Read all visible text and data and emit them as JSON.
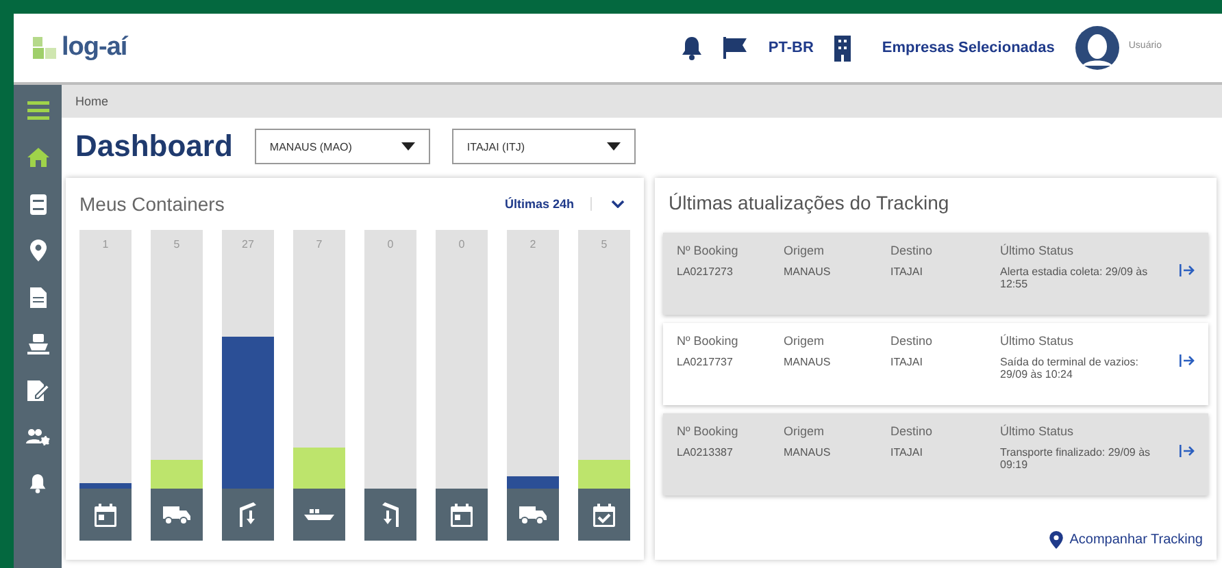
{
  "header": {
    "logo": "log-aí",
    "language": "PT-BR",
    "companies": "Empresas Selecionadas",
    "user": "Usuário"
  },
  "sidebar": {
    "items": [
      {
        "kind": "home",
        "selected": true
      },
      {
        "kind": "book",
        "selected": false
      },
      {
        "kind": "pin",
        "selected": false
      },
      {
        "kind": "document",
        "selected": false
      },
      {
        "kind": "ship",
        "selected": false
      },
      {
        "kind": "signature",
        "selected": false
      },
      {
        "kind": "people",
        "selected": false
      },
      {
        "kind": "bell",
        "selected": false
      }
    ]
  },
  "breadcrumb": "Home",
  "title": "Dashboard",
  "filters": [
    {
      "value": "MANAUS (MAO)"
    },
    {
      "value": "ITAJAI (ITJ)"
    }
  ],
  "containers": {
    "title": "Meus Containers",
    "period": "Últimas 24h",
    "bars": [
      {
        "count": "1",
        "level": 0.02,
        "color": "#2b4f96",
        "kind": "calendar"
      },
      {
        "count": "5",
        "level": 0.11,
        "color": "#bde46c",
        "kind": "truck"
      },
      {
        "count": "27",
        "level": 0.59,
        "color": "#2b4f96",
        "kind": "crane"
      },
      {
        "count": "7",
        "level": 0.16,
        "color": "#bde46c",
        "kind": "ship"
      },
      {
        "count": "0",
        "level": 0,
        "kind": "crane-mirror"
      },
      {
        "count": "0",
        "level": 0,
        "kind": "calendar"
      },
      {
        "count": "2",
        "level": 0.05,
        "color": "#2b4f96",
        "kind": "truck"
      },
      {
        "count": "5",
        "level": 0.11,
        "color": "#bde46c",
        "kind": "calendar-check"
      }
    ]
  },
  "tracking": {
    "title": "Últimas atualizações do Tracking",
    "rows": [
      {
        "highlighted": true,
        "booking_label": "Nº Booking",
        "booking": "LA0217273",
        "origin_label": "Origem",
        "origin": "MANAUS",
        "destination_label": "Destino",
        "destination": "ITAJAI",
        "status_label": "Último Status",
        "status": "Alerta estadia coleta: 29/09 às 12:55"
      },
      {
        "highlighted": false,
        "booking_label": "Nº Booking",
        "booking": "LA0217737",
        "origin_label": "Origem",
        "origin": "MANAUS",
        "destination_label": "Destino",
        "destination": "ITAJAI",
        "status_label": "Último Status",
        "status": "Saída do terminal de vazios: 29/09 às 10:24"
      },
      {
        "highlighted": true,
        "booking_label": "Nº Booking",
        "booking": "LA0213387",
        "origin_label": "Origem",
        "origin": "MANAUS",
        "destination_label": "Destino",
        "destination": "ITAJAI",
        "status_label": "Último Status",
        "status": "Transporte finalizado: 29/09 às 09:19"
      }
    ],
    "link": "Acompanhar Tracking"
  }
}
